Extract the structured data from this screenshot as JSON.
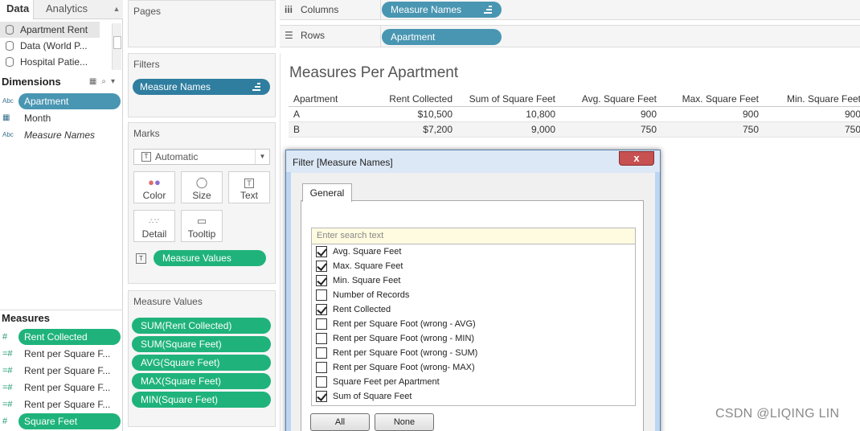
{
  "left_pane": {
    "tabs": [
      {
        "label": "Data",
        "active": true
      },
      {
        "label": "Analytics",
        "active": false
      }
    ],
    "data_sources": [
      {
        "label": "Apartment Rent",
        "selected": true
      },
      {
        "label": "Data (World P...",
        "selected": false
      },
      {
        "label": "Hospital Patie...",
        "selected": false
      }
    ],
    "dimensions_header": "Dimensions",
    "dimensions": [
      {
        "type": "Abc",
        "label": "Apartment",
        "pill": true
      },
      {
        "type": "cal",
        "label": "Month",
        "pill": false
      },
      {
        "type": "Abc",
        "label": "Measure Names",
        "pill": false,
        "italic": true
      }
    ],
    "measures_header": "Measures",
    "measures": [
      {
        "type": "#",
        "label": "Rent Collected",
        "pill": true
      },
      {
        "type": "=#",
        "label": "Rent per Square F...",
        "pill": false
      },
      {
        "type": "=#",
        "label": "Rent per Square F...",
        "pill": false
      },
      {
        "type": "=#",
        "label": "Rent per Square F...",
        "pill": false
      },
      {
        "type": "=#",
        "label": "Rent per Square F...",
        "pill": false
      },
      {
        "type": "#",
        "label": "Square Feet",
        "pill": true
      }
    ]
  },
  "cards": {
    "pages_title": "Pages",
    "filters_title": "Filters",
    "filter_pill": "Measure Names",
    "marks_title": "Marks",
    "marks_type": "Automatic",
    "mark_buttons": [
      {
        "label": "Color",
        "icon": "color-dots-icon"
      },
      {
        "label": "Size",
        "icon": "size-icon"
      },
      {
        "label": "Text",
        "icon": "text-icon"
      },
      {
        "label": "Detail",
        "icon": "detail-icon"
      },
      {
        "label": "Tooltip",
        "icon": "tooltip-icon"
      }
    ],
    "marks_pill": "Measure Values",
    "measure_values_title": "Measure Values",
    "measure_values": [
      "SUM(Rent Collected)",
      "SUM(Square Feet)",
      "AVG(Square Feet)",
      "MAX(Square Feet)",
      "MIN(Square Feet)"
    ]
  },
  "shelves": {
    "columns_label": "Columns",
    "columns_pill": "Measure Names",
    "rows_label": "Rows",
    "rows_pill": "Apartment"
  },
  "view": {
    "title": "Measures Per Apartment",
    "table": {
      "headers": [
        "Apartment",
        "Rent Collected",
        "Sum of Square Feet",
        "Avg. Square Feet",
        "Max. Square Feet",
        "Min. Square Feet"
      ],
      "rows": [
        [
          "A",
          "$10,500",
          "10,800",
          "900",
          "900",
          "900"
        ],
        [
          "B",
          "$7,200",
          "9,000",
          "750",
          "750",
          "750"
        ]
      ]
    }
  },
  "dialog": {
    "title": "Filter [Measure Names]",
    "close_label": "x",
    "tab": "General",
    "search_placeholder": "Enter search text",
    "items": [
      {
        "label": "Avg. Square Feet",
        "checked": true
      },
      {
        "label": "Max. Square Feet",
        "checked": true
      },
      {
        "label": "Min. Square Feet",
        "checked": true
      },
      {
        "label": "Number of Records",
        "checked": false
      },
      {
        "label": "Rent Collected",
        "checked": true
      },
      {
        "label": "Rent per Square Foot (wrong - AVG)",
        "checked": false
      },
      {
        "label": "Rent per Square Foot (wrong - MIN)",
        "checked": false
      },
      {
        "label": "Rent per Square Foot (wrong - SUM)",
        "checked": false
      },
      {
        "label": "Rent per Square Foot (wrong- MAX)",
        "checked": false
      },
      {
        "label": "Square Feet per Apartment",
        "checked": false
      },
      {
        "label": "Sum of Square Feet",
        "checked": true
      }
    ],
    "all_button": "All",
    "none_button": "None"
  },
  "watermark": "CSDN @LIQING LIN",
  "colors": {
    "dimension_pill": "#4996b2",
    "measure_pill": "#1fb37b",
    "filter_pill": "#2f7ea0"
  }
}
